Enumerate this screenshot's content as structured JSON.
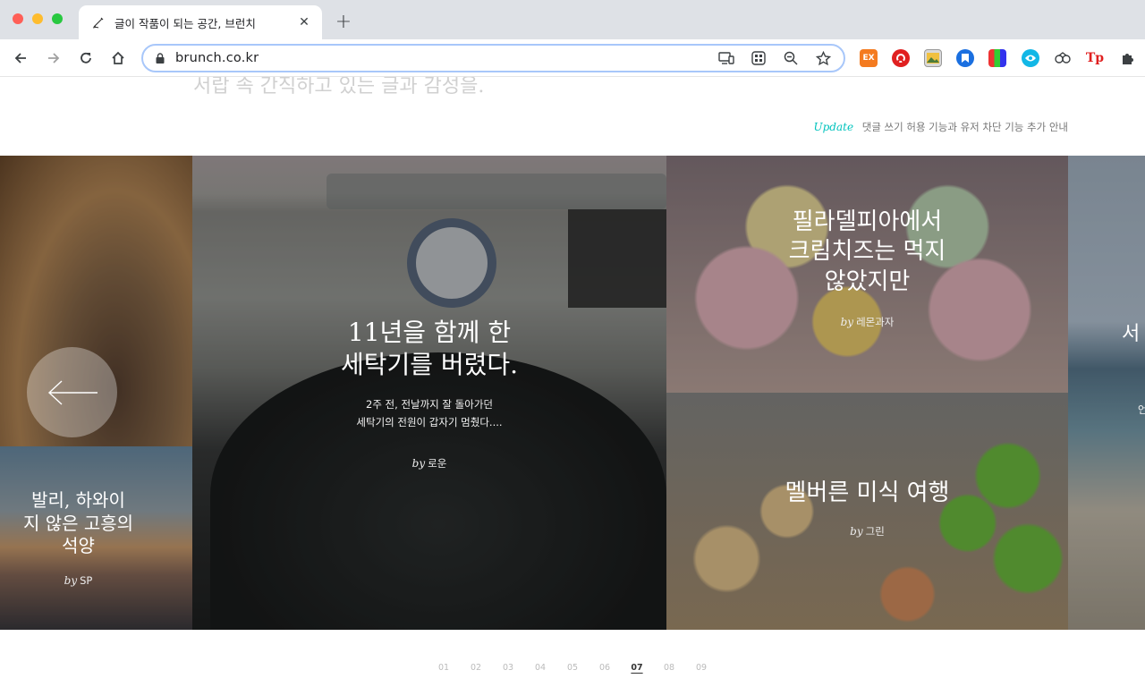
{
  "browser": {
    "tab_title": "글이 작품이 되는 공간, 브런치",
    "tab_close": "✕",
    "new_tab": "+",
    "url": "brunch.co.kr",
    "extensions": {
      "ex_label": "EX",
      "tp_label": "Tp"
    }
  },
  "page": {
    "tagline": "서랍 속 간직하고 있는 글과 감성을.",
    "update": {
      "label": "Update",
      "text": "댓글 쓰기 허용 기능과 유저 차단 기능 추가 안내"
    },
    "cards": [
      {
        "title_lines": [
          "발리, 하와이",
          "지 않은 고흥의",
          "석양"
        ],
        "by": "by",
        "author": "SP"
      },
      {
        "title_lines": [
          "11년을 함께 한",
          "세탁기를 버렸다."
        ],
        "desc_lines": [
          "2주 전, 전날까지 잘 돌아가던",
          "세탁기의 전원이 갑자기 멈췄다...."
        ],
        "by": "by",
        "author": "로운"
      },
      {
        "title_lines": [
          "필라델피아에서",
          "크림치즈는 먹지",
          "않았지만"
        ],
        "by": "by",
        "author": "레몬과자"
      },
      {
        "title_lines": [
          "멜버른 미식 여행"
        ],
        "by": "by",
        "author": "그린"
      },
      {
        "title_lines": [
          "서"
        ],
        "desc_lines": [
          "언"
        ]
      }
    ],
    "pager": [
      "01",
      "02",
      "03",
      "04",
      "05",
      "06",
      "07",
      "08",
      "09"
    ],
    "pager_active": "07"
  },
  "colors": {
    "accent": "#00c3bd",
    "omnibox_border": "#a8c7fa"
  }
}
